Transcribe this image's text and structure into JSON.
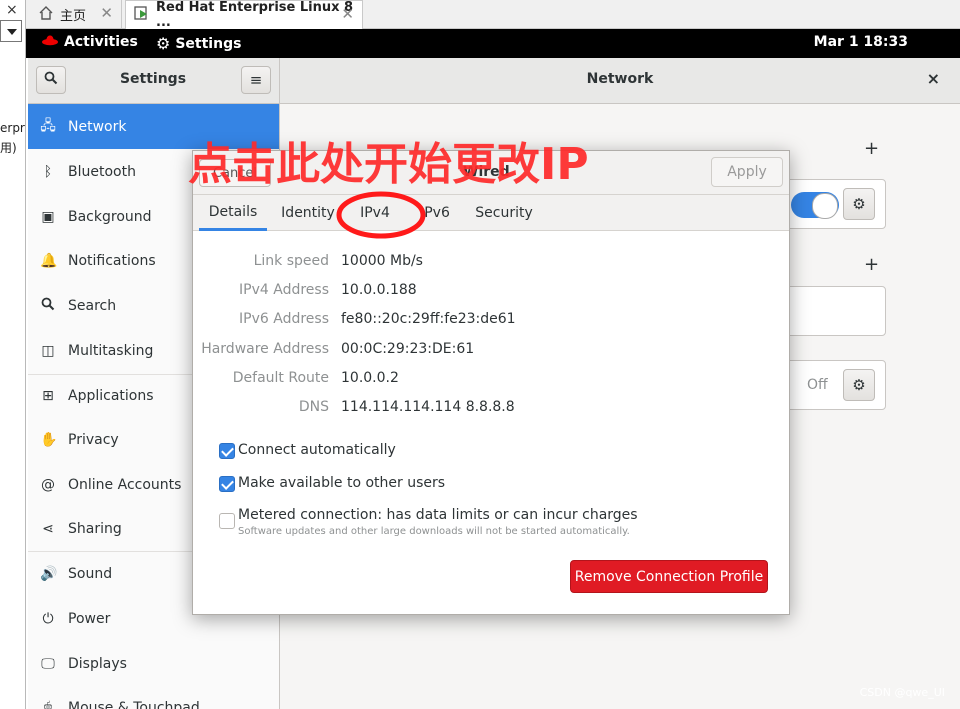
{
  "host": {
    "left_close": "×",
    "left_clip_lines": [
      "erpri",
      "用)"
    ],
    "tabs": [
      {
        "label": "主页",
        "close": "✕"
      },
      {
        "label": "Red Hat Enterprise Linux 8 ...",
        "close": "✕"
      }
    ]
  },
  "topbar": {
    "activities": "Activities",
    "app": "Settings",
    "clock": "Mar 1  18:33"
  },
  "header": {
    "settings_title": "Settings",
    "network_title": "Network",
    "close": "×"
  },
  "sidebar": {
    "items": [
      {
        "label": "Network",
        "icon": "network-icon",
        "selected": true
      },
      {
        "label": "Bluetooth",
        "icon": "bluetooth-icon"
      },
      {
        "label": "Background",
        "icon": "background-icon"
      },
      {
        "label": "Notifications",
        "icon": "bell-icon"
      },
      {
        "label": "Search",
        "icon": "search-icon"
      },
      {
        "label": "Multitasking",
        "icon": "multitasking-icon"
      },
      {
        "label": "Applications",
        "icon": "applications-icon"
      },
      {
        "label": "Privacy",
        "icon": "hand-icon"
      },
      {
        "label": "Online Accounts",
        "icon": "at-icon"
      },
      {
        "label": "Sharing",
        "icon": "share-icon"
      },
      {
        "label": "Sound",
        "icon": "speaker-icon"
      },
      {
        "label": "Power",
        "icon": "power-icon"
      },
      {
        "label": "Displays",
        "icon": "display-icon"
      },
      {
        "label": "Mouse & Touchpad",
        "icon": "mouse-icon"
      }
    ]
  },
  "network_panel": {
    "off_label": "Off"
  },
  "dialog": {
    "cancel": "Cancel",
    "title": "Wired",
    "apply": "Apply",
    "tabs": [
      "Details",
      "Identity",
      "IPv4",
      "IPv6",
      "Security"
    ],
    "active_tab": "Details",
    "details": [
      {
        "label": "Link speed",
        "value": "10000 Mb/s"
      },
      {
        "label": "IPv4 Address",
        "value": "10.0.0.188"
      },
      {
        "label": "IPv6 Address",
        "value": "fe80::20c:29ff:fe23:de61"
      },
      {
        "label": "Hardware Address",
        "value": "00:0C:29:23:DE:61"
      },
      {
        "label": "Default Route",
        "value": "10.0.0.2"
      },
      {
        "label": "DNS",
        "value": "114.114.114.114 8.8.8.8"
      }
    ],
    "checkboxes": [
      {
        "label": "Connect automatically",
        "checked": true
      },
      {
        "label": "Make available to other users",
        "checked": true
      },
      {
        "label": "Metered connection: has data limits or can incur charges",
        "checked": false,
        "sublabel": "Software updates and other large downloads will not be started automatically."
      }
    ],
    "remove_button": "Remove Connection Profile"
  },
  "annotation": {
    "text": "点击此处开始更改IP",
    "color": "#ff2a2a"
  },
  "watermark": "CSDN @qwe_UI",
  "colors": {
    "accent": "#3584e4",
    "destructive": "#e01b24",
    "topbar": "#000000"
  }
}
